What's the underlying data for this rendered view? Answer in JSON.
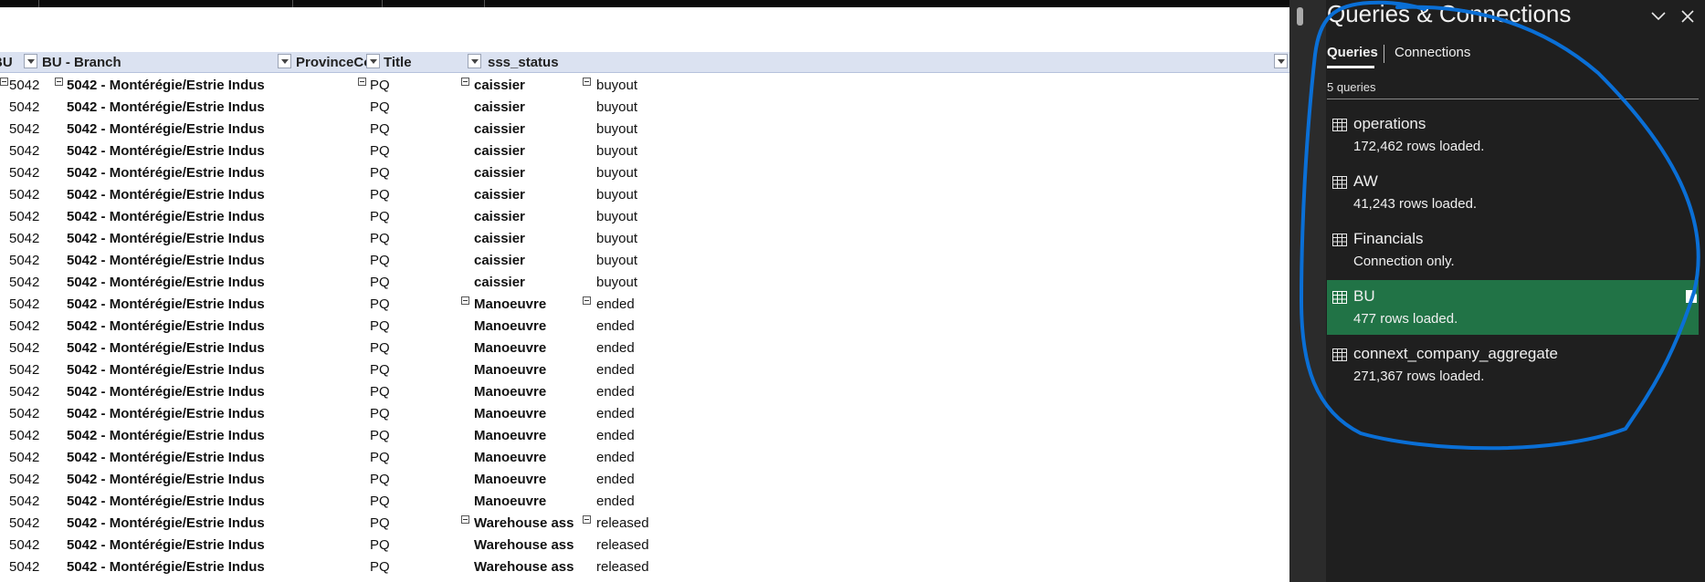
{
  "sheet": {
    "headers": [
      {
        "label": "BU"
      },
      {
        "label": "BU - Branch"
      },
      {
        "label": "ProvinceCode"
      },
      {
        "label": "Title"
      },
      {
        "label": "sss_status"
      }
    ],
    "rows": [
      {
        "bu": "5042",
        "branch": "5042 - Montérégie/Estrie Indus",
        "prov": "PQ",
        "title": "caissier",
        "status": "buyout"
      },
      {
        "bu": "5042",
        "branch": "5042 - Montérégie/Estrie Indus",
        "prov": "PQ",
        "title": "caissier",
        "status": "buyout"
      },
      {
        "bu": "5042",
        "branch": "5042 - Montérégie/Estrie Indus",
        "prov": "PQ",
        "title": "caissier",
        "status": "buyout"
      },
      {
        "bu": "5042",
        "branch": "5042 - Montérégie/Estrie Indus",
        "prov": "PQ",
        "title": "caissier",
        "status": "buyout"
      },
      {
        "bu": "5042",
        "branch": "5042 - Montérégie/Estrie Indus",
        "prov": "PQ",
        "title": "caissier",
        "status": "buyout"
      },
      {
        "bu": "5042",
        "branch": "5042 - Montérégie/Estrie Indus",
        "prov": "PQ",
        "title": "caissier",
        "status": "buyout"
      },
      {
        "bu": "5042",
        "branch": "5042 - Montérégie/Estrie Indus",
        "prov": "PQ",
        "title": "caissier",
        "status": "buyout"
      },
      {
        "bu": "5042",
        "branch": "5042 - Montérégie/Estrie Indus",
        "prov": "PQ",
        "title": "caissier",
        "status": "buyout"
      },
      {
        "bu": "5042",
        "branch": "5042 - Montérégie/Estrie Indus",
        "prov": "PQ",
        "title": "caissier",
        "status": "buyout"
      },
      {
        "bu": "5042",
        "branch": "5042 - Montérégie/Estrie Indus",
        "prov": "PQ",
        "title": "caissier",
        "status": "buyout"
      },
      {
        "bu": "5042",
        "branch": "5042 - Montérégie/Estrie Indus",
        "prov": "PQ",
        "title": "Manoeuvre",
        "status": "ended"
      },
      {
        "bu": "5042",
        "branch": "5042 - Montérégie/Estrie Indus",
        "prov": "PQ",
        "title": "Manoeuvre",
        "status": "ended"
      },
      {
        "bu": "5042",
        "branch": "5042 - Montérégie/Estrie Indus",
        "prov": "PQ",
        "title": "Manoeuvre",
        "status": "ended"
      },
      {
        "bu": "5042",
        "branch": "5042 - Montérégie/Estrie Indus",
        "prov": "PQ",
        "title": "Manoeuvre",
        "status": "ended"
      },
      {
        "bu": "5042",
        "branch": "5042 - Montérégie/Estrie Indus",
        "prov": "PQ",
        "title": "Manoeuvre",
        "status": "ended"
      },
      {
        "bu": "5042",
        "branch": "5042 - Montérégie/Estrie Indus",
        "prov": "PQ",
        "title": "Manoeuvre",
        "status": "ended"
      },
      {
        "bu": "5042",
        "branch": "5042 - Montérégie/Estrie Indus",
        "prov": "PQ",
        "title": "Manoeuvre",
        "status": "ended"
      },
      {
        "bu": "5042",
        "branch": "5042 - Montérégie/Estrie Indus",
        "prov": "PQ",
        "title": "Manoeuvre",
        "status": "ended"
      },
      {
        "bu": "5042",
        "branch": "5042 - Montérégie/Estrie Indus",
        "prov": "PQ",
        "title": "Manoeuvre",
        "status": "ended"
      },
      {
        "bu": "5042",
        "branch": "5042 - Montérégie/Estrie Indus",
        "prov": "PQ",
        "title": "Manoeuvre",
        "status": "ended"
      },
      {
        "bu": "5042",
        "branch": "5042 - Montérégie/Estrie Indus",
        "prov": "PQ",
        "title": "Warehouse ass",
        "status": "released"
      },
      {
        "bu": "5042",
        "branch": "5042 - Montérégie/Estrie Indus",
        "prov": "PQ",
        "title": "Warehouse ass",
        "status": "released"
      },
      {
        "bu": "5042",
        "branch": "5042 - Montérégie/Estrie Indus",
        "prov": "PQ",
        "title": "Warehouse ass",
        "status": "released"
      }
    ]
  },
  "pane": {
    "title": "Queries & Connections",
    "tabs": {
      "queries": "Queries",
      "connections": "Connections"
    },
    "query_count": "5 queries",
    "queries": [
      {
        "name": "operations",
        "status": "172,462 rows loaded."
      },
      {
        "name": "AW",
        "status": "41,243 rows loaded."
      },
      {
        "name": "Financials",
        "status": "Connection only."
      },
      {
        "name": "BU",
        "status": "477 rows loaded."
      },
      {
        "name": "connext_company_aggregate",
        "status": "271,367 rows loaded."
      }
    ],
    "selected_color": "#217346"
  },
  "colors": {
    "annotation": "#0a6fd6",
    "pane_bg": "#1f1f1f",
    "header_bg": "#dbe2f1"
  }
}
